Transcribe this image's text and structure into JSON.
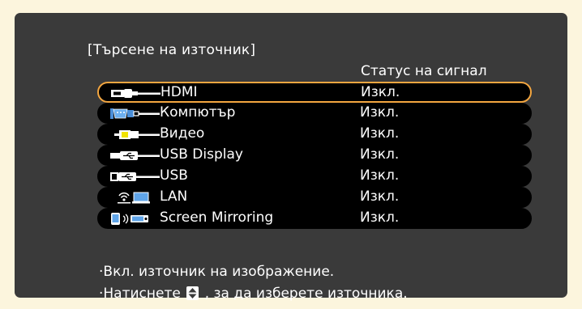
{
  "dialog": {
    "title": "[Търсене на източник]",
    "status_header": "Статус на сигнал"
  },
  "sources": [
    {
      "name": "HDMI",
      "status": "Изкл.",
      "icon": "hdmi-cable-icon",
      "selected": true
    },
    {
      "name": "Компютър",
      "status": "Изкл.",
      "icon": "vga-cable-icon",
      "selected": false
    },
    {
      "name": "Видео",
      "status": "Изкл.",
      "icon": "rca-video-cable-icon",
      "selected": false
    },
    {
      "name": "USB Display",
      "status": "Изкл.",
      "icon": "usb-display-cable-icon",
      "selected": false
    },
    {
      "name": "USB",
      "status": "Изкл.",
      "icon": "usb-cable-icon",
      "selected": false
    },
    {
      "name": "LAN",
      "status": "Изкл.",
      "icon": "lan-wireless-icon",
      "selected": false
    },
    {
      "name": "Screen Mirroring",
      "status": "Изкл.",
      "icon": "screen-mirroring-icon",
      "selected": false
    }
  ],
  "help": {
    "line1": "·Вкл. източник на изображение.",
    "line2_prefix": "·Натиснете",
    "line2_suffix": ", за да изберете източника.",
    "key_icon": "up-down-arrow-icon"
  },
  "colors": {
    "page_background": "#fcf5dd",
    "screen_background": "#3a3a3a",
    "row_background": "#000000",
    "selection_border": "#f3a640",
    "text": "#ffffff"
  }
}
